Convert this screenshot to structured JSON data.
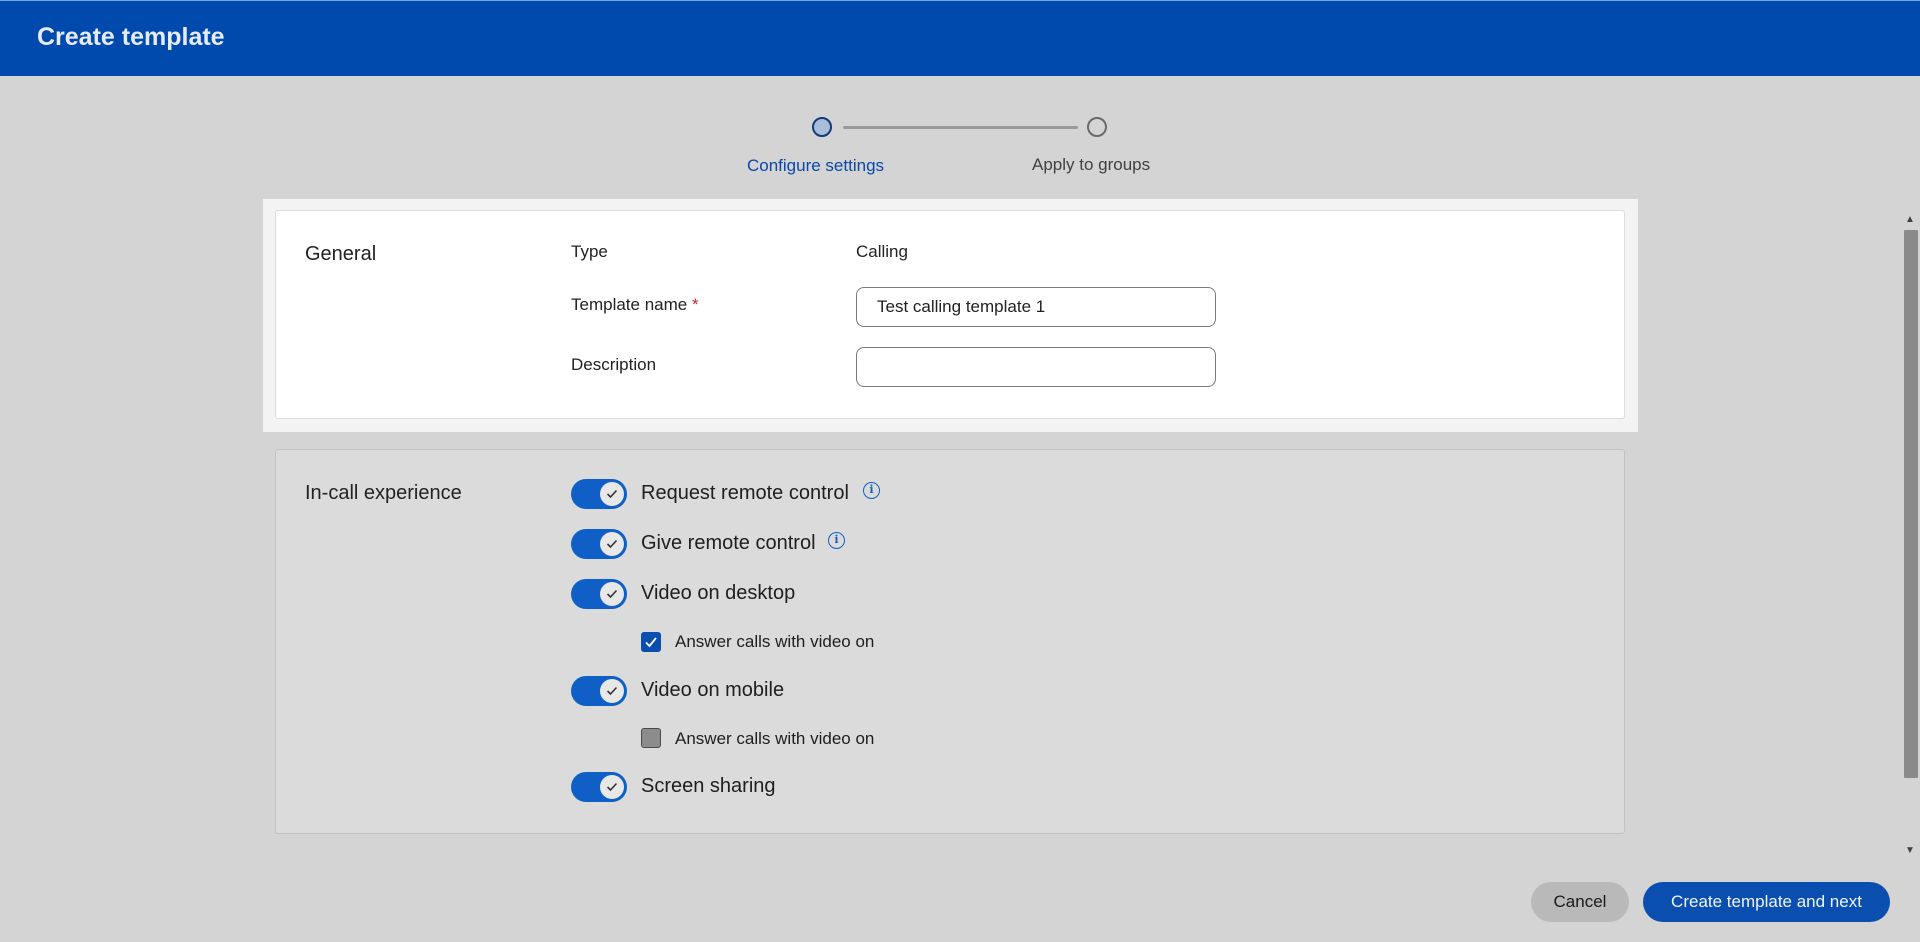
{
  "header": {
    "title": "Create template"
  },
  "stepper": {
    "steps": [
      {
        "label": "Configure settings",
        "active": true
      },
      {
        "label": "Apply to groups",
        "active": false
      }
    ]
  },
  "general": {
    "title": "General",
    "type_label": "Type",
    "type_value": "Calling",
    "template_name_label": "Template name",
    "required_marker": "*",
    "template_name_value": "Test calling template 1",
    "description_label": "Description",
    "description_value": ""
  },
  "in_call": {
    "title": "In-call experience",
    "options": [
      {
        "label": "Request remote control",
        "enabled": true,
        "info": true
      },
      {
        "label": "Give remote control",
        "enabled": true,
        "info": true
      },
      {
        "label": "Video on desktop",
        "enabled": true,
        "info": false
      },
      {
        "label": "Video on mobile",
        "enabled": true,
        "info": false
      },
      {
        "label": "Screen sharing",
        "enabled": true,
        "info": false
      }
    ],
    "desktop_answer_video": {
      "label": "Answer calls with video on",
      "checked": true
    },
    "mobile_answer_video": {
      "label": "Answer calls with video on",
      "checked": false
    }
  },
  "footer": {
    "cancel_label": "Cancel",
    "primary_label": "Create template and next"
  },
  "colors": {
    "header": "#004aad",
    "accent": "#0f5fc7",
    "primary_button": "#0a4fb0"
  }
}
